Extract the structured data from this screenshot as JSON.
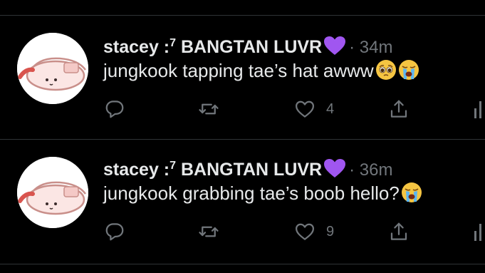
{
  "tweets": [
    {
      "display_name": "stacey :",
      "name_superscript": "7",
      "name_suffix": " BANGTAN LUVR",
      "time": "· 34m",
      "text": "jungkook tapping tae’s hat awww",
      "emojis": [
        "pleading-face-emoji",
        "loudly-crying-face-emoji"
      ],
      "reply_count": "",
      "retweet_count": "",
      "like_count": "4"
    },
    {
      "display_name": "stacey :",
      "name_superscript": "7",
      "name_suffix": " BANGTAN LUVR",
      "time": "· 36m",
      "text": "jungkook grabbing tae’s boob hello?",
      "emojis": [
        "loudly-crying-face-emoji"
      ],
      "reply_count": "",
      "retweet_count": "",
      "like_count": "9"
    }
  ],
  "icons": {
    "name_emoji": "purple-heart-emoji",
    "reply": "reply-icon",
    "retweet": "retweet-icon",
    "like": "like-icon",
    "share": "share-icon",
    "analytics": "analytics-icon"
  },
  "colors": {
    "background": "#000000",
    "text_primary": "#e7e9ea",
    "text_secondary": "#71767b",
    "divider": "#2f3336",
    "purple_heart": "#a056f0"
  }
}
